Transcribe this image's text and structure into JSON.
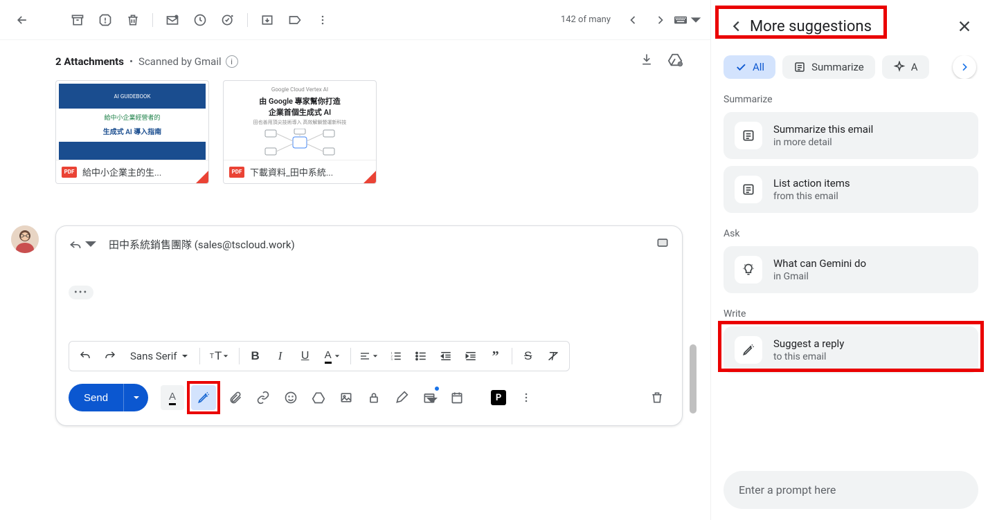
{
  "toolbar": {
    "counter": "142 of many"
  },
  "attachments": {
    "count_label": "2 Attachments",
    "scanned": "Scanned by Gmail",
    "items": [
      {
        "badge": "PDF",
        "name": "給中小企業主的生...",
        "t_top": "AI GUIDEBOOK",
        "t_mid": "給中小企業經營者的",
        "t_main": "生成式 AI 導入指南"
      },
      {
        "badge": "PDF",
        "name": "下載資料_田中系統...",
        "t1": "Google Cloud Vertex AI",
        "t2": "由 Google 專家幫你打造",
        "t3": "企業首個生成式 AI",
        "t4": "田也善用頂尖技術導入 高效解鎖營運新科技"
      }
    ]
  },
  "compose": {
    "recipient": "田中系統銷售團隊 (sales@tscloud.work)",
    "trimmed": "•••",
    "font": "Sans Serif",
    "send": "Send",
    "p_badge": "P"
  },
  "side": {
    "title": "More suggestions",
    "chips": {
      "all": "All",
      "summarize": "Summarize",
      "ask": "A"
    },
    "sections": {
      "summarize": "Summarize",
      "ask": "Ask",
      "write": "Write"
    },
    "cards": {
      "sum1_t": "Summarize this email",
      "sum1_s": "in more detail",
      "sum2_t": "List action items",
      "sum2_s": "from this email",
      "ask1_t": "What can Gemini do",
      "ask1_s": "in Gmail",
      "write1_t": "Suggest a reply",
      "write1_s": "to this email"
    },
    "prompt_placeholder": "Enter a prompt here"
  }
}
